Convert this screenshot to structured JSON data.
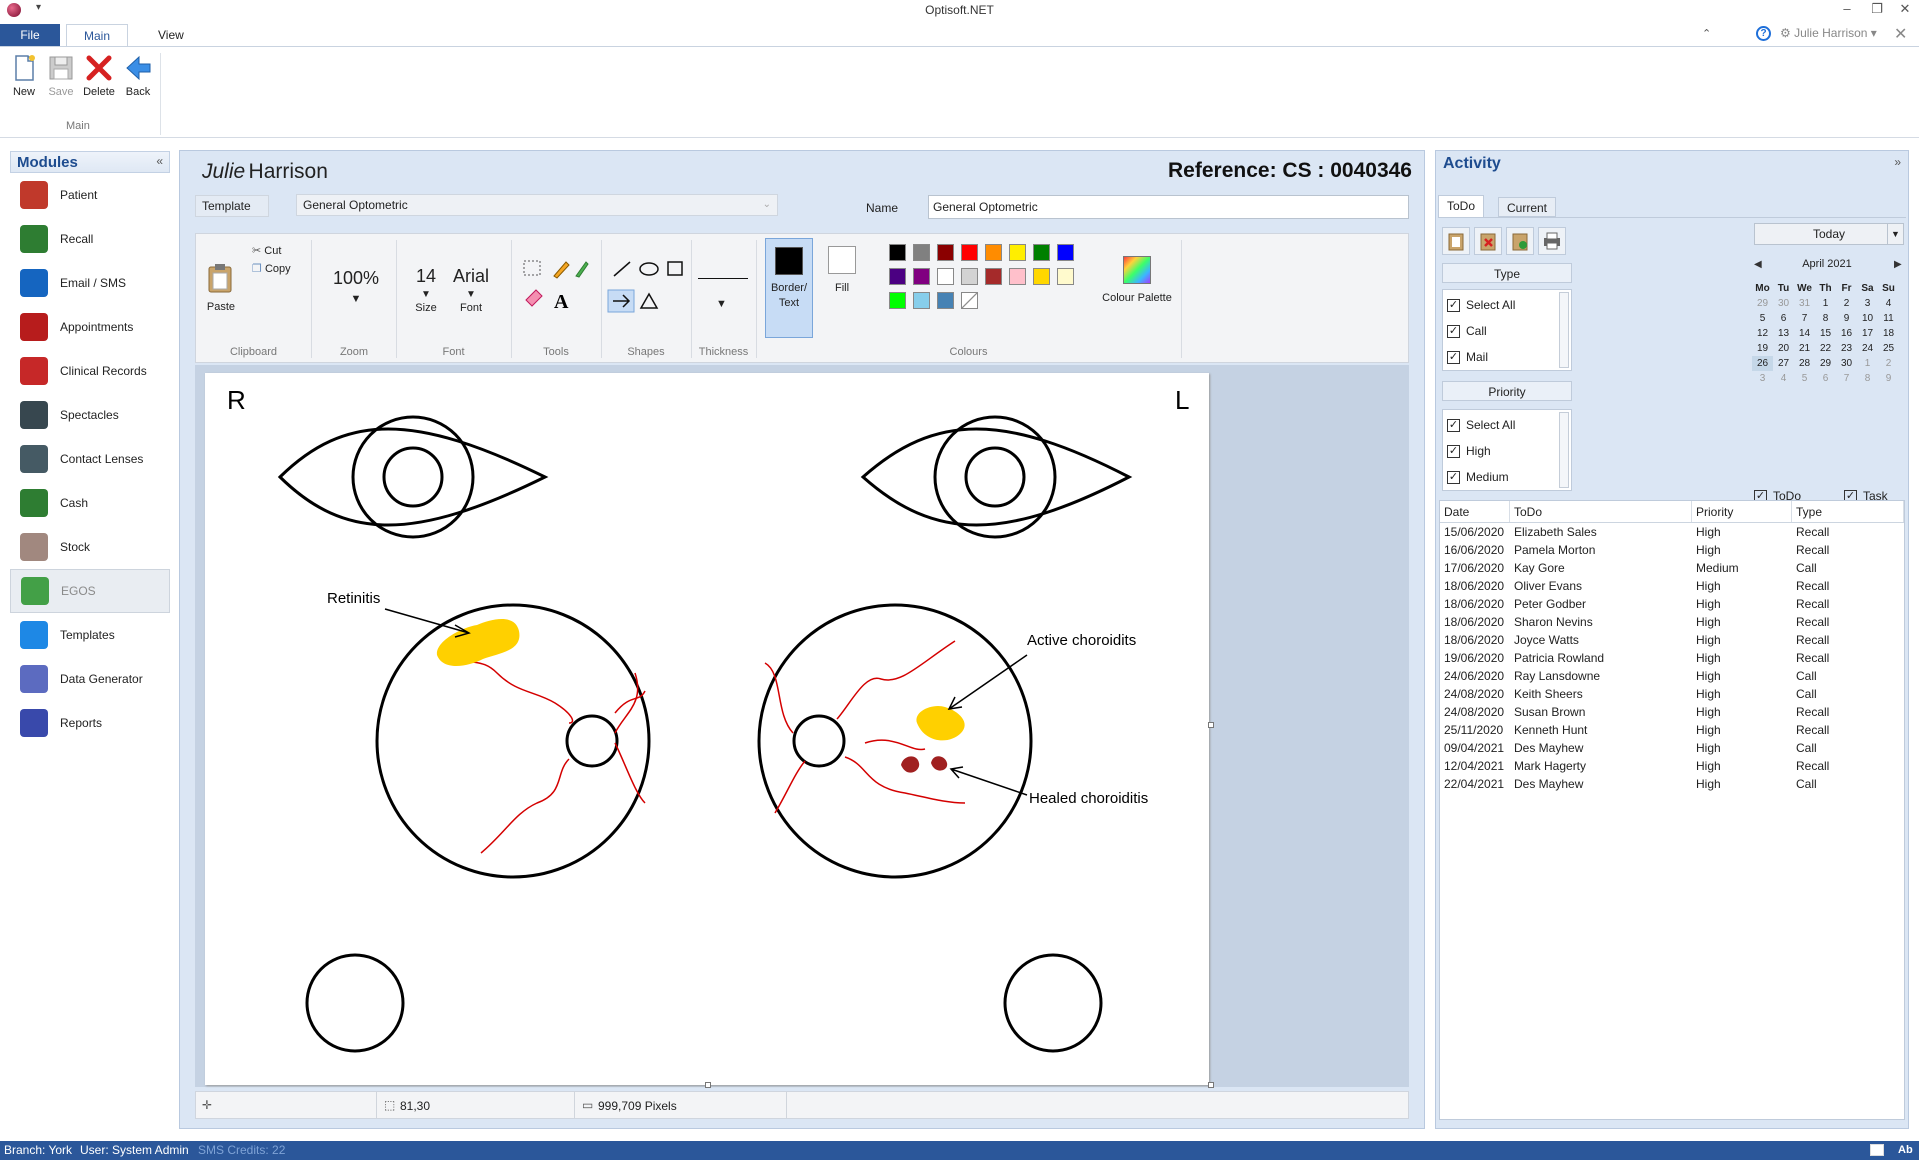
{
  "window": {
    "title": "Optisoft.NET",
    "user": "Julie Harrison"
  },
  "tabs": {
    "file": "File",
    "main": "Main",
    "view": "View"
  },
  "ribbon": {
    "new": "New",
    "save": "Save",
    "delete": "Delete",
    "back": "Back",
    "group": "Main"
  },
  "modules": {
    "title": "Modules",
    "items": [
      {
        "label": "Patient",
        "color": "#c0392b"
      },
      {
        "label": "Recall",
        "color": "#2e7d32"
      },
      {
        "label": "Email / SMS",
        "color": "#1565c0"
      },
      {
        "label": "Appointments",
        "color": "#b71c1c"
      },
      {
        "label": "Clinical Records",
        "color": "#c62828"
      },
      {
        "label": "Spectacles",
        "color": "#37474f"
      },
      {
        "label": "Contact Lenses",
        "color": "#455a64"
      },
      {
        "label": "Cash",
        "color": "#2e7d32"
      },
      {
        "label": "Stock",
        "color": "#a1887f"
      },
      {
        "label": "EGOS",
        "color": "#43a047"
      },
      {
        "label": "Templates",
        "color": "#1e88e5"
      },
      {
        "label": "Data Generator",
        "color": "#5c6bc0"
      },
      {
        "label": "Reports",
        "color": "#3949ab"
      }
    ]
  },
  "patient": {
    "first": "Julie",
    "last": "Harrison",
    "reference": "Reference: CS : 0040346"
  },
  "template": {
    "button": "Template",
    "value": "General Optometric",
    "name_label": "Name",
    "name_value": "General Optometric"
  },
  "draw": {
    "paste": "Paste",
    "cut": "Cut",
    "copy": "Copy",
    "clipboard": "Clipboard",
    "zoom_value": "100%",
    "zoom": "Zoom",
    "size_value": "14",
    "size": "Size",
    "font_value": "Arial",
    "font_label": "Font",
    "font_group": "Font",
    "tools": "Tools",
    "shapes": "Shapes",
    "thickness": "Thickness",
    "border_text": "Border/\nText",
    "fill": "Fill",
    "colours": "Colours",
    "colour_palette": "Colour Palette",
    "swatches": [
      "#000000",
      "#808080",
      "#8b0000",
      "#ff0000",
      "#ff8c00",
      "#ffee00",
      "#008000",
      "#0000ff",
      "#4b0082",
      "#800080",
      "#ffffff",
      "#d3d3d3",
      "#a52a2a",
      "#ffc0cb",
      "#ffd700",
      "#fffacd",
      "#00ff00",
      "#87ceeb",
      "#4682b4",
      "none"
    ]
  },
  "canvas": {
    "right_label": "R",
    "left_label": "L",
    "retinitis": "Retinitis",
    "active": "Active choroidits",
    "healed": "Healed choroiditis"
  },
  "status": {
    "coords": "81,30",
    "pixels": "999,709 Pixels"
  },
  "activity": {
    "title": "Activity",
    "tabs": [
      "ToDo",
      "Current"
    ],
    "type_header": "Type",
    "type_items": [
      "Select All",
      "Call",
      "Mail"
    ],
    "priority_header": "Priority",
    "priority_items": [
      "Select All",
      "High",
      "Medium"
    ],
    "today": "Today",
    "month": "April 2021",
    "weekdays": [
      "Mo",
      "Tu",
      "We",
      "Th",
      "Fr",
      "Sa",
      "Su"
    ],
    "weeks": [
      [
        "29",
        "30",
        "31",
        "1",
        "2",
        "3",
        "4"
      ],
      [
        "5",
        "6",
        "7",
        "8",
        "9",
        "10",
        "11"
      ],
      [
        "12",
        "13",
        "14",
        "15",
        "16",
        "17",
        "18"
      ],
      [
        "19",
        "20",
        "21",
        "22",
        "23",
        "24",
        "25"
      ],
      [
        "26",
        "27",
        "28",
        "29",
        "30",
        "1",
        "2"
      ],
      [
        "3",
        "4",
        "5",
        "6",
        "7",
        "8",
        "9"
      ]
    ],
    "chk_todo": "ToDo",
    "chk_task": "Task",
    "columns": [
      "Date",
      "ToDo",
      "Priority",
      "Type"
    ],
    "rows": [
      [
        "15/06/2020",
        "Elizabeth Sales",
        "High",
        "Recall"
      ],
      [
        "16/06/2020",
        "Pamela Morton",
        "High",
        "Recall"
      ],
      [
        "17/06/2020",
        "Kay Gore",
        "Medium",
        "Call"
      ],
      [
        "18/06/2020",
        "Oliver Evans",
        "High",
        "Recall"
      ],
      [
        "18/06/2020",
        "Peter Godber",
        "High",
        "Recall"
      ],
      [
        "18/06/2020",
        "Sharon Nevins",
        "High",
        "Recall"
      ],
      [
        "18/06/2020",
        "Joyce Watts",
        "High",
        "Recall"
      ],
      [
        "19/06/2020",
        "Patricia Rowland",
        "High",
        "Recall"
      ],
      [
        "24/06/2020",
        "Ray Lansdowne",
        "High",
        "Call"
      ],
      [
        "24/08/2020",
        "Keith Sheers",
        "High",
        "Call"
      ],
      [
        "24/08/2020",
        "Susan Brown",
        "High",
        "Recall"
      ],
      [
        "25/11/2020",
        "Kenneth Hunt",
        "High",
        "Recall"
      ],
      [
        "09/04/2021",
        "Des Mayhew",
        "High",
        "Call"
      ],
      [
        "12/04/2021",
        "Mark Hagerty",
        "High",
        "Recall"
      ],
      [
        "22/04/2021",
        "Des Mayhew",
        "High",
        "Call"
      ]
    ]
  },
  "bottom": {
    "branch": "Branch: York",
    "user": "User: System Admin",
    "credits": "SMS Credits: 22"
  }
}
